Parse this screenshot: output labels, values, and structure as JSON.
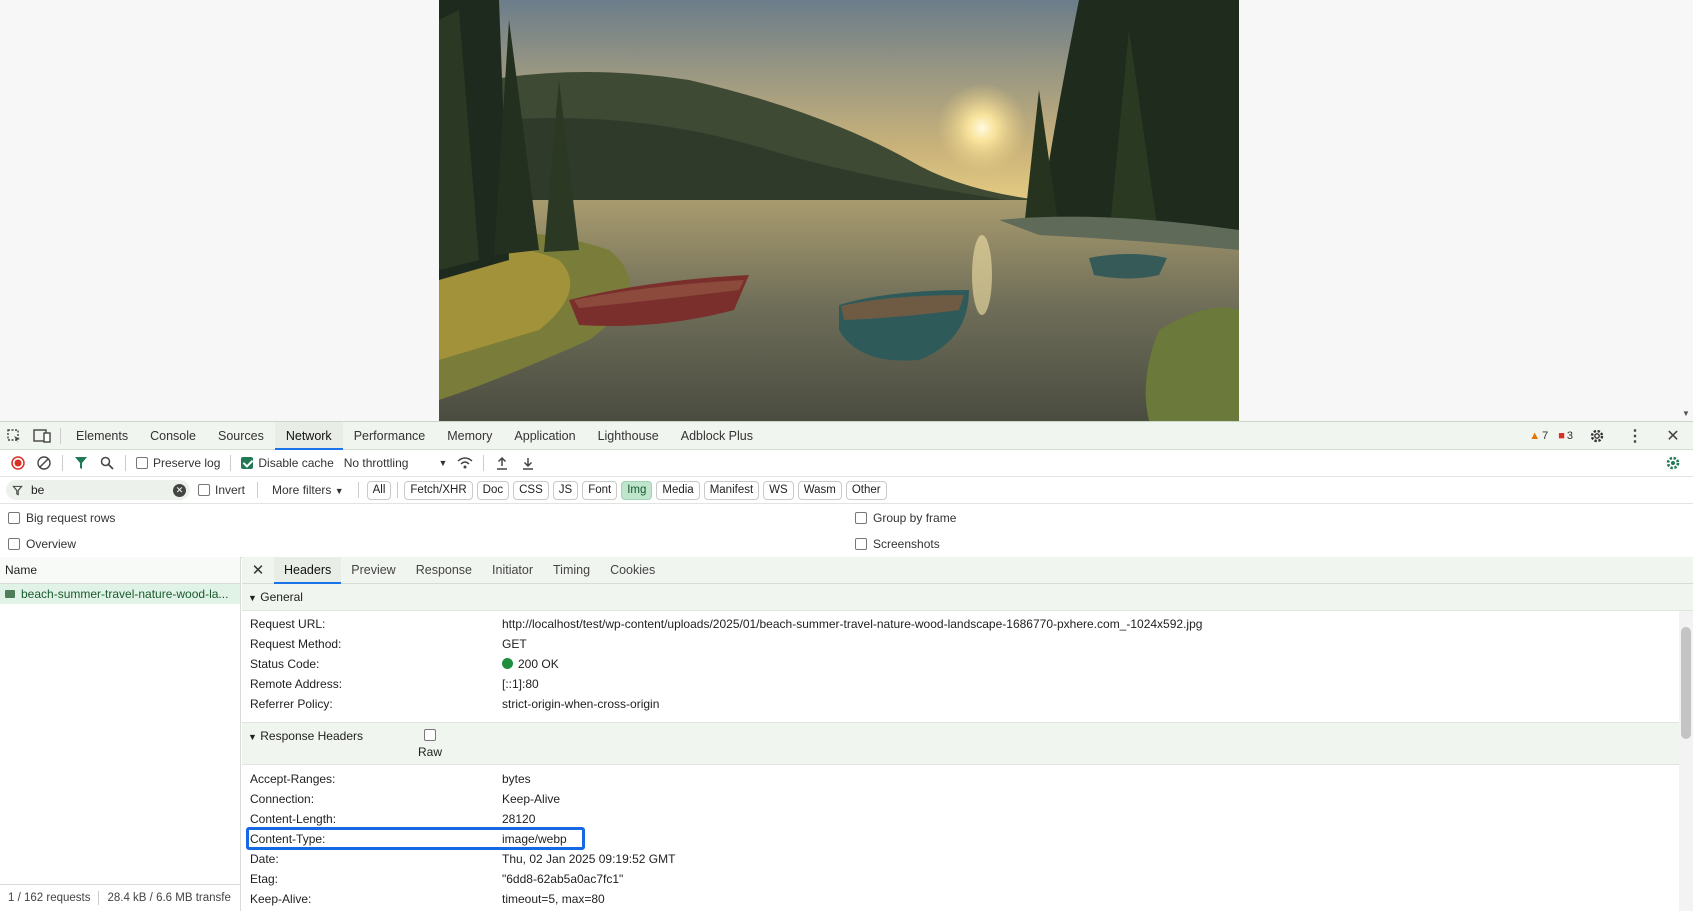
{
  "devtools": {
    "tabs": [
      "Elements",
      "Console",
      "Sources",
      "Network",
      "Performance",
      "Memory",
      "Application",
      "Lighthouse",
      "Adblock Plus"
    ],
    "active_tab": "Network",
    "warnings": "7",
    "errors": "3"
  },
  "toolbar": {
    "preserve_log": "Preserve log",
    "disable_cache": "Disable cache",
    "throttling": "No throttling"
  },
  "filter": {
    "value": "be",
    "invert": "Invert",
    "more_filters": "More filters",
    "types": [
      "All",
      "Fetch/XHR",
      "Doc",
      "CSS",
      "JS",
      "Font",
      "Img",
      "Media",
      "Manifest",
      "WS",
      "Wasm",
      "Other"
    ],
    "active_type": "Img"
  },
  "options": {
    "big_rows": "Big request rows",
    "overview": "Overview",
    "group_by_frame": "Group by frame",
    "screenshots": "Screenshots"
  },
  "request_list": {
    "column_name": "Name",
    "selected": "beach-summer-travel-nature-wood-la...",
    "status_requests": "1 / 162 requests",
    "status_transfer": "28.4 kB / 6.6 MB transfe"
  },
  "details": {
    "tabs": [
      "Headers",
      "Preview",
      "Response",
      "Initiator",
      "Timing",
      "Cookies"
    ],
    "active_tab": "Headers",
    "general_title": "General",
    "general": [
      {
        "key": "Request URL:",
        "value": "http://localhost/test/wp-content/uploads/2025/01/beach-summer-travel-nature-wood-landscape-1686770-pxhere.com_-1024x592.jpg"
      },
      {
        "key": "Request Method:",
        "value": "GET"
      },
      {
        "key": "Status Code:",
        "value": "200 OK"
      },
      {
        "key": "Remote Address:",
        "value": "[::1]:80"
      },
      {
        "key": "Referrer Policy:",
        "value": "strict-origin-when-cross-origin"
      }
    ],
    "response_title": "Response Headers",
    "raw_label": "Raw",
    "response": [
      {
        "key": "Accept-Ranges:",
        "value": "bytes"
      },
      {
        "key": "Connection:",
        "value": "Keep-Alive"
      },
      {
        "key": "Content-Length:",
        "value": "28120"
      },
      {
        "key": "Content-Type:",
        "value": "image/webp"
      },
      {
        "key": "Date:",
        "value": "Thu, 02 Jan 2025 09:19:52 GMT"
      },
      {
        "key": "Etag:",
        "value": "\"6dd8-62ab5a0ac7fc1\""
      },
      {
        "key": "Keep-Alive:",
        "value": "timeout=5, max=80"
      }
    ]
  },
  "colors": {
    "accent": "#1a73e8",
    "highlight": "#1668e3",
    "status_ok": "#1e8e3e"
  }
}
